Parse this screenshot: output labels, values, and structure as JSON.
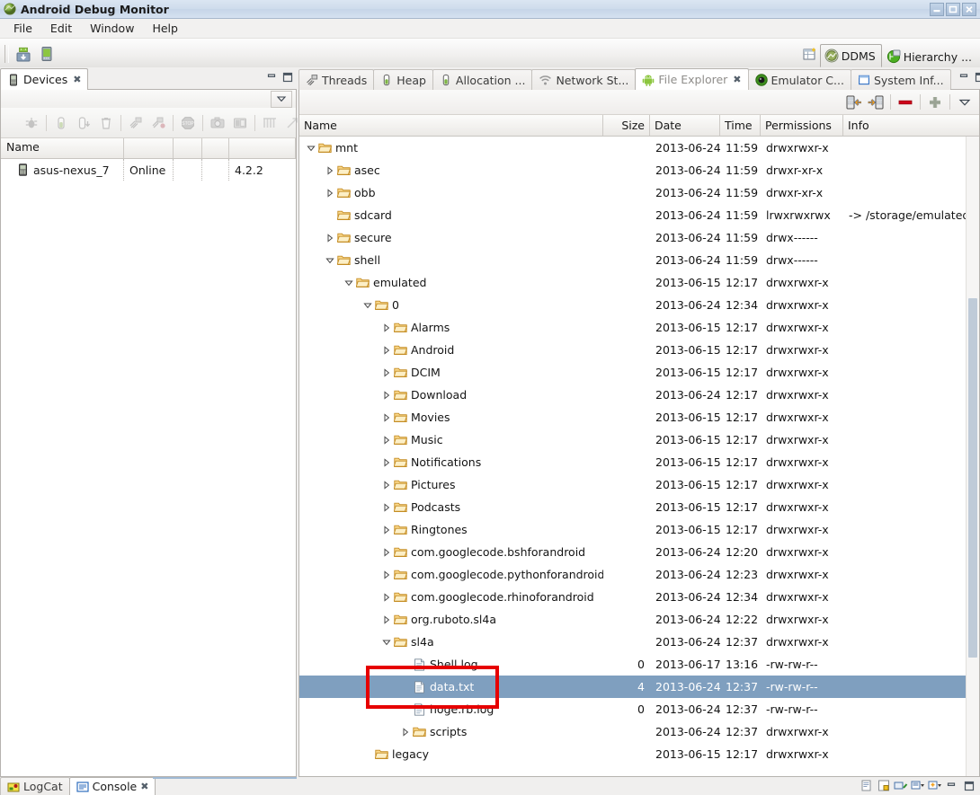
{
  "window": {
    "title": "Android Debug Monitor",
    "icon": "android-head-icon",
    "buttons": {
      "minimize": "minimize-icon",
      "maximize": "maximize-icon",
      "close": "close-icon"
    }
  },
  "menubar": {
    "items": [
      "File",
      "Edit",
      "Window",
      "Help"
    ]
  },
  "toolbar": {
    "items": [
      {
        "name": "screen-capture-icon",
        "tooltip": "Screen Capture"
      },
      {
        "name": "device-screenshot-icon",
        "tooltip": "Device Screenshot"
      }
    ]
  },
  "perspective": {
    "open_button": "open-perspective-icon",
    "items": [
      {
        "label": "DDMS",
        "icon": "ddms-icon",
        "active": true
      },
      {
        "label": "Hierarchy ...",
        "icon": "hierarchy-view-icon",
        "active": false
      }
    ]
  },
  "devices_view": {
    "tab": {
      "label": "Devices",
      "icon": "device-icon",
      "close": "✖"
    },
    "view_buttons": [
      {
        "name": "minimize-view-icon"
      },
      {
        "name": "maximize-view-icon"
      }
    ],
    "menu_button": "view-menu-icon",
    "toolbar_icons": [
      "debug-icon",
      "heap-update-icon",
      "heap-dump-icon",
      "gc-icon",
      "thread-update-icon",
      "method-profiling-icon",
      "stop-process-icon",
      "screen-capture-icon",
      "dump-view-hierarchy-icon",
      "systrace-icon",
      "reset-adb-icon"
    ],
    "columns": [
      "Name",
      "",
      "",
      "",
      ""
    ],
    "rows": [
      {
        "icon": "device-icon",
        "name": "asus-nexus_7",
        "state": "Online",
        "col3": "",
        "col4": "",
        "version": "4.2.2"
      }
    ]
  },
  "right_view_tabs": [
    {
      "label": "Threads",
      "icon": "threads-icon",
      "active": false,
      "closable": false
    },
    {
      "label": "Heap",
      "icon": "heap-icon",
      "active": false,
      "closable": false
    },
    {
      "label": "Allocation ...",
      "icon": "allocation-tracker-icon",
      "active": false,
      "closable": false
    },
    {
      "label": "Network St...",
      "icon": "network-icon",
      "active": false,
      "closable": false
    },
    {
      "label": "File Explorer",
      "icon": "android-icon",
      "active": true,
      "closable": true,
      "close": "✖"
    },
    {
      "label": "Emulator C...",
      "icon": "emulator-control-icon",
      "active": false,
      "closable": false
    },
    {
      "label": "System Inf...",
      "icon": "system-info-icon",
      "active": false,
      "closable": false
    }
  ],
  "right_view_buttons": [
    {
      "name": "minimize-view-icon"
    },
    {
      "name": "maximize-view-icon"
    }
  ],
  "file_explorer": {
    "toolbar_icons": [
      {
        "name": "pull-file-icon"
      },
      {
        "name": "push-file-icon"
      },
      {
        "name": "delete-icon"
      },
      {
        "name": "new-folder-icon"
      },
      {
        "name": "view-menu-icon"
      }
    ],
    "columns": [
      "Name",
      "Size",
      "Date",
      "Time",
      "Permissions",
      "Info"
    ],
    "rows": [
      {
        "indent": 0,
        "twisty": "down",
        "icon": "folder-icon",
        "name": "mnt",
        "size": "",
        "date": "2013-06-24",
        "time": "11:59",
        "perm": "drwxrwxr-x",
        "info": "",
        "selected": false
      },
      {
        "indent": 1,
        "twisty": "right",
        "icon": "folder-icon",
        "name": "asec",
        "size": "",
        "date": "2013-06-24",
        "time": "11:59",
        "perm": "drwxr-xr-x",
        "info": "",
        "selected": false
      },
      {
        "indent": 1,
        "twisty": "right",
        "icon": "folder-icon",
        "name": "obb",
        "size": "",
        "date": "2013-06-24",
        "time": "11:59",
        "perm": "drwxr-xr-x",
        "info": "",
        "selected": false
      },
      {
        "indent": 1,
        "twisty": "none",
        "icon": "folder-icon",
        "name": "sdcard",
        "size": "",
        "date": "2013-06-24",
        "time": "11:59",
        "perm": "lrwxrwxrwx",
        "info": "-> /storage/emulated/",
        "selected": false
      },
      {
        "indent": 1,
        "twisty": "right",
        "icon": "folder-icon",
        "name": "secure",
        "size": "",
        "date": "2013-06-24",
        "time": "11:59",
        "perm": "drwx------",
        "info": "",
        "selected": false
      },
      {
        "indent": 1,
        "twisty": "down",
        "icon": "folder-icon",
        "name": "shell",
        "size": "",
        "date": "2013-06-24",
        "time": "11:59",
        "perm": "drwx------",
        "info": "",
        "selected": false
      },
      {
        "indent": 2,
        "twisty": "down",
        "icon": "folder-icon",
        "name": "emulated",
        "size": "",
        "date": "2013-06-15",
        "time": "12:17",
        "perm": "drwxrwxr-x",
        "info": "",
        "selected": false
      },
      {
        "indent": 3,
        "twisty": "down",
        "icon": "folder-icon",
        "name": "0",
        "size": "",
        "date": "2013-06-24",
        "time": "12:34",
        "perm": "drwxrwxr-x",
        "info": "",
        "selected": false
      },
      {
        "indent": 4,
        "twisty": "right",
        "icon": "folder-icon",
        "name": "Alarms",
        "size": "",
        "date": "2013-06-15",
        "time": "12:17",
        "perm": "drwxrwxr-x",
        "info": "",
        "selected": false
      },
      {
        "indent": 4,
        "twisty": "right",
        "icon": "folder-icon",
        "name": "Android",
        "size": "",
        "date": "2013-06-15",
        "time": "12:17",
        "perm": "drwxrwxr-x",
        "info": "",
        "selected": false
      },
      {
        "indent": 4,
        "twisty": "right",
        "icon": "folder-icon",
        "name": "DCIM",
        "size": "",
        "date": "2013-06-15",
        "time": "12:17",
        "perm": "drwxrwxr-x",
        "info": "",
        "selected": false
      },
      {
        "indent": 4,
        "twisty": "right",
        "icon": "folder-icon",
        "name": "Download",
        "size": "",
        "date": "2013-06-24",
        "time": "12:17",
        "perm": "drwxrwxr-x",
        "info": "",
        "selected": false
      },
      {
        "indent": 4,
        "twisty": "right",
        "icon": "folder-icon",
        "name": "Movies",
        "size": "",
        "date": "2013-06-15",
        "time": "12:17",
        "perm": "drwxrwxr-x",
        "info": "",
        "selected": false
      },
      {
        "indent": 4,
        "twisty": "right",
        "icon": "folder-icon",
        "name": "Music",
        "size": "",
        "date": "2013-06-15",
        "time": "12:17",
        "perm": "drwxrwxr-x",
        "info": "",
        "selected": false
      },
      {
        "indent": 4,
        "twisty": "right",
        "icon": "folder-icon",
        "name": "Notifications",
        "size": "",
        "date": "2013-06-15",
        "time": "12:17",
        "perm": "drwxrwxr-x",
        "info": "",
        "selected": false
      },
      {
        "indent": 4,
        "twisty": "right",
        "icon": "folder-icon",
        "name": "Pictures",
        "size": "",
        "date": "2013-06-15",
        "time": "12:17",
        "perm": "drwxrwxr-x",
        "info": "",
        "selected": false
      },
      {
        "indent": 4,
        "twisty": "right",
        "icon": "folder-icon",
        "name": "Podcasts",
        "size": "",
        "date": "2013-06-15",
        "time": "12:17",
        "perm": "drwxrwxr-x",
        "info": "",
        "selected": false
      },
      {
        "indent": 4,
        "twisty": "right",
        "icon": "folder-icon",
        "name": "Ringtones",
        "size": "",
        "date": "2013-06-15",
        "time": "12:17",
        "perm": "drwxrwxr-x",
        "info": "",
        "selected": false
      },
      {
        "indent": 4,
        "twisty": "right",
        "icon": "folder-icon",
        "name": "com.googlecode.bshforandroid",
        "size": "",
        "date": "2013-06-24",
        "time": "12:20",
        "perm": "drwxrwxr-x",
        "info": "",
        "selected": false
      },
      {
        "indent": 4,
        "twisty": "right",
        "icon": "folder-icon",
        "name": "com.googlecode.pythonforandroid",
        "size": "",
        "date": "2013-06-24",
        "time": "12:23",
        "perm": "drwxrwxr-x",
        "info": "",
        "selected": false
      },
      {
        "indent": 4,
        "twisty": "right",
        "icon": "folder-icon",
        "name": "com.googlecode.rhinoforandroid",
        "size": "",
        "date": "2013-06-24",
        "time": "12:34",
        "perm": "drwxrwxr-x",
        "info": "",
        "selected": false
      },
      {
        "indent": 4,
        "twisty": "right",
        "icon": "folder-icon",
        "name": "org.ruboto.sl4a",
        "size": "",
        "date": "2013-06-24",
        "time": "12:22",
        "perm": "drwxrwxr-x",
        "info": "",
        "selected": false
      },
      {
        "indent": 4,
        "twisty": "down",
        "icon": "folder-icon",
        "name": "sl4a",
        "size": "",
        "date": "2013-06-24",
        "time": "12:37",
        "perm": "drwxrwxr-x",
        "info": "",
        "selected": false
      },
      {
        "indent": 5,
        "twisty": "none",
        "icon": "file-icon",
        "name": "Shell.log",
        "size": "0",
        "date": "2013-06-17",
        "time": "13:16",
        "perm": "-rw-rw-r--",
        "info": "",
        "selected": false
      },
      {
        "indent": 5,
        "twisty": "none",
        "icon": "file-icon",
        "name": "data.txt",
        "size": "4",
        "date": "2013-06-24",
        "time": "12:37",
        "perm": "-rw-rw-r--",
        "info": "",
        "selected": true
      },
      {
        "indent": 5,
        "twisty": "none",
        "icon": "file-icon",
        "name": "hoge.rb.log",
        "size": "0",
        "date": "2013-06-24",
        "time": "12:37",
        "perm": "-rw-rw-r--",
        "info": "",
        "selected": false
      },
      {
        "indent": 5,
        "twisty": "right",
        "icon": "folder-icon",
        "name": "scripts",
        "size": "",
        "date": "2013-06-24",
        "time": "12:37",
        "perm": "drwxrwxr-x",
        "info": "",
        "selected": false
      },
      {
        "indent": 3,
        "twisty": "none",
        "icon": "folder-icon",
        "name": "legacy",
        "size": "",
        "date": "2013-06-15",
        "time": "12:17",
        "perm": "drwxrwxr-x",
        "info": "",
        "selected": false
      }
    ],
    "annotation": {
      "name": "highlight-box",
      "color": "#e60000",
      "target_row": "data.txt"
    }
  },
  "bottom_tabs": [
    {
      "label": "LogCat",
      "icon": "logcat-icon",
      "active": false,
      "closable": false
    },
    {
      "label": "Console",
      "icon": "console-icon",
      "active": true,
      "closable": true,
      "close": "✖"
    }
  ],
  "bottom_buttons": [
    {
      "name": "open-console-icon"
    },
    {
      "name": "pin-console-icon"
    },
    {
      "name": "scroll-lock-icon"
    },
    {
      "name": "display-selected-console-icon"
    },
    {
      "name": "open-console-dropdown-icon"
    },
    {
      "name": "minimize-view-icon"
    },
    {
      "name": "maximize-view-icon"
    }
  ],
  "colors": {
    "selection": "#7f9fbf",
    "annotation": "#e60000",
    "folder": "#f0b64a",
    "android_green": "#8cc63f"
  }
}
